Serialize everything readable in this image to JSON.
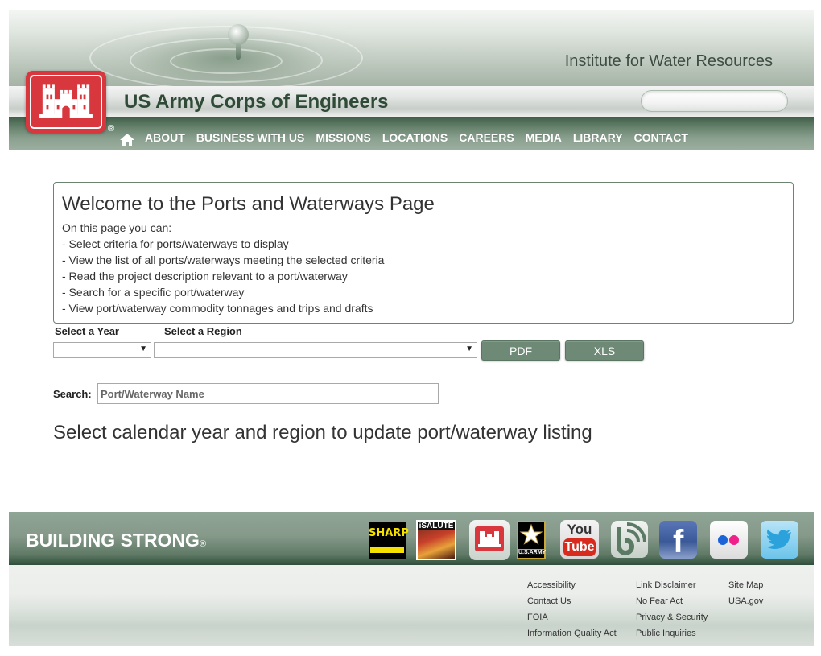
{
  "header": {
    "institute_title": "Institute for Water Resources",
    "agency_name": "US Army Corps of Engineers",
    "registered_mark": "®",
    "nav": [
      {
        "label": "ABOUT"
      },
      {
        "label": "BUSINESS WITH US"
      },
      {
        "label": "MISSIONS"
      },
      {
        "label": "LOCATIONS"
      },
      {
        "label": "CAREERS"
      },
      {
        "label": "MEDIA"
      },
      {
        "label": "LIBRARY"
      },
      {
        "label": "CONTACT"
      }
    ],
    "search": {
      "value": "",
      "placeholder": ""
    }
  },
  "welcome": {
    "title": "Welcome to the Ports and Waterways Page",
    "intro": "On this page you can:",
    "items": [
      "- Select criteria for ports/waterways to display",
      "- View the list of all ports/waterways meeting the selected criteria",
      "- Read the project description relevant to a port/waterway",
      "- Search for a specific port/waterway",
      "- View port/waterway commodity tonnages and trips and drafts"
    ]
  },
  "filters": {
    "year_label": "Select a Year",
    "year_value": "",
    "region_label": "Select a Region",
    "region_value": "",
    "pdf_button": "PDF",
    "xls_button": "XLS",
    "dropdown_arrow": "▼"
  },
  "search": {
    "label": "Search:",
    "value": "",
    "placeholder": "Port/Waterway Name"
  },
  "status_message": "Select calendar year and region to update port/waterway listing",
  "footer": {
    "slogan": "BUILDING STRONG",
    "slogan_mark": "®",
    "social_icons": [
      {
        "name": "sharp-icon",
        "label": "SHARP"
      },
      {
        "name": "isalute-icon",
        "label": "iSALUTE"
      },
      {
        "name": "usace-castle-icon",
        "label": ""
      },
      {
        "name": "us-army-icon",
        "label": "U.S.ARMY"
      },
      {
        "name": "youtube-icon",
        "label": "You Tube"
      },
      {
        "name": "blog-icon",
        "label": ""
      },
      {
        "name": "facebook-icon",
        "label": "f"
      },
      {
        "name": "flickr-icon",
        "label": ""
      },
      {
        "name": "twitter-icon",
        "label": ""
      }
    ],
    "links": {
      "col1": [
        "Accessibility",
        "Contact Us",
        "FOIA",
        "Information Quality Act"
      ],
      "col2": [
        "Link Disclaimer",
        "No Fear Act",
        "Privacy & Security",
        "Public Inquiries"
      ],
      "col3": [
        "Site Map",
        "USA.gov"
      ]
    }
  },
  "colors": {
    "brand_green": "#6e8a76",
    "nav_green": "#3f5e48",
    "logo_red": "#d8373e",
    "text": "#333333"
  }
}
